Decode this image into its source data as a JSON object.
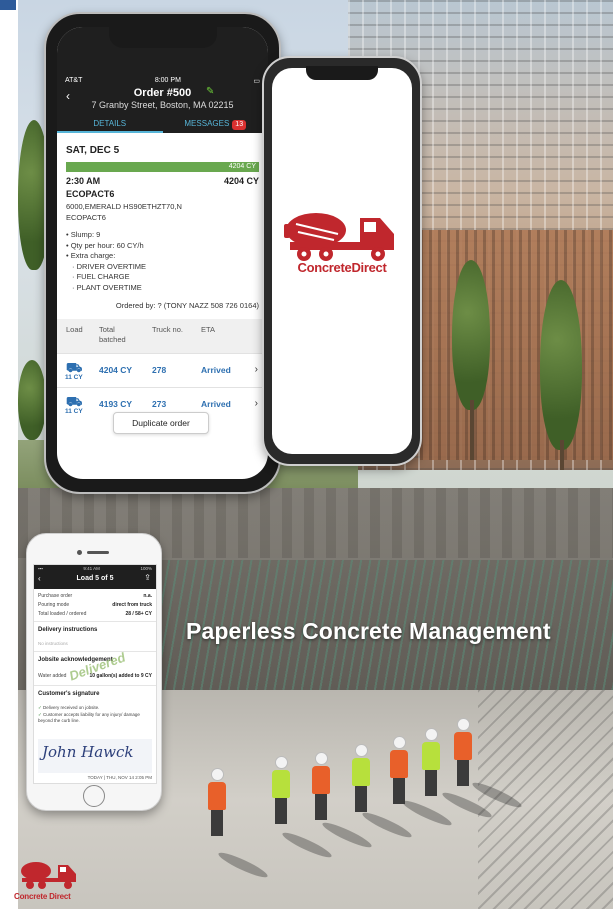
{
  "colors": {
    "brand_red": "#c0272d",
    "accent_blue": "#57b5d8",
    "progress_green": "#69a84f",
    "link_blue": "#2d6fb0"
  },
  "tagline": "Paperless Concrete Management",
  "order_phone": {
    "status": {
      "carrier": "AT&T",
      "time": "8:00 PM"
    },
    "title": "Order #500",
    "address": "7 Granby Street, Boston, MA 02215",
    "tabs": [
      {
        "label": "DETAILS",
        "active": true
      },
      {
        "label": "MESSAGES",
        "active": false,
        "badge": "13"
      }
    ],
    "date": "SAT, DEC 5",
    "progress_label": "4204 CY",
    "progress_fraction": 1.0,
    "time": "2:30 AM",
    "quantity": "4204 CY",
    "mix": "ECOPACT6",
    "mix_desc": "6000,EMERALD HS90ETHZT70,N",
    "mix_desc2": "ECOPACT6",
    "details": [
      "• Slump: 9",
      "• Qty per hour: 60 CY/h",
      "• Extra charge:",
      "  · DRIVER OVERTIME",
      "  · FUEL CHARGE",
      "  · PLANT OVERTIME"
    ],
    "ordered_by": "Ordered by: ? (TONY NAZZ 508 726 0164)",
    "table_headers": {
      "load": "Load",
      "total": "Total batched",
      "truck": "Truck no.",
      "eta": "ETA"
    },
    "rows": [
      {
        "load_cy": "11 CY",
        "total": "4204 CY",
        "truck": "278",
        "eta": "Arrived"
      },
      {
        "load_cy": "11 CY",
        "total": "4193 CY",
        "truck": "273",
        "eta": "Arrived"
      }
    ],
    "duplicate_button": "Duplicate order"
  },
  "logo_phone": {
    "brand_text": "ConcreteDirect"
  },
  "ticket_phone": {
    "status": {
      "time": "9:41 AM",
      "battery": "100%"
    },
    "title": "Load 5 of 5",
    "rows": [
      {
        "label": "Purchase order",
        "value": "n.a."
      },
      {
        "label": "Pouring mode",
        "value": "direct from truck"
      },
      {
        "label": "Total loaded / ordered",
        "value": "28 / 58+ CY"
      }
    ],
    "delivery_instructions_title": "Delivery instructions",
    "delivery_instructions_value": "No instructions",
    "jobsite_title": "Jobsite acknowledgement",
    "water_label": "Water added",
    "water_value": "10 gallon(s) added to 9 CY",
    "stamp": "Delivered",
    "signature_title": "Customer's signature",
    "checks": [
      "Delivery received on jobsite.",
      "Customer accepts liability for any injury/ damage beyond the curb line."
    ],
    "signature": "John Hawck",
    "signed_date": "TODAY | THU, NOV 14 2:05 PM"
  },
  "footer_logo": {
    "brand_text": "Concrete Direct"
  }
}
